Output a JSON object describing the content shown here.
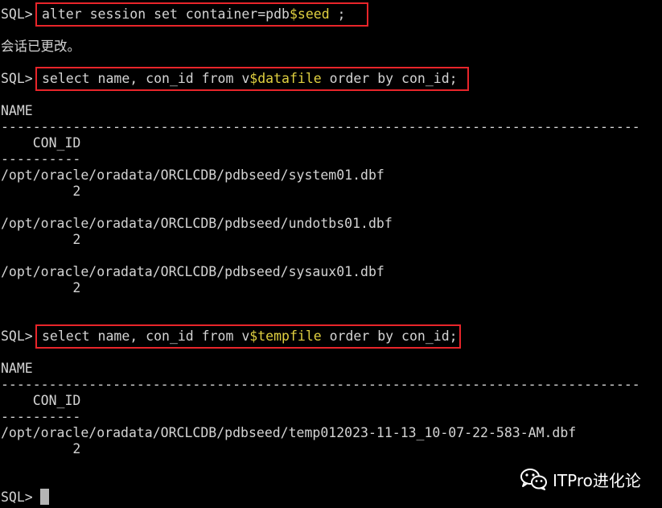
{
  "terminal": {
    "prompt": "SQL>",
    "blocks": [
      {
        "command": {
          "pre": "alter session set container=pdb",
          "var": "$seed",
          "post": " ;"
        },
        "message": "会话已更改。"
      },
      {
        "command": {
          "pre": "select name, con_id from v",
          "var": "$datafile",
          "post": " order by con_id;"
        },
        "col_name": "NAME",
        "name_rule": "--------------------------------------------------------------------------------",
        "col_conid": "    CON_ID",
        "conid_rule": "----------",
        "rows": [
          {
            "name": "/opt/oracle/oradata/ORCLCDB/pdbseed/system01.dbf",
            "con_id": "         2"
          },
          {
            "name": "/opt/oracle/oradata/ORCLCDB/pdbseed/undotbs01.dbf",
            "con_id": "         2"
          },
          {
            "name": "/opt/oracle/oradata/ORCLCDB/pdbseed/sysaux01.dbf",
            "con_id": "         2"
          }
        ]
      },
      {
        "command": {
          "pre": "select name, con_id from v",
          "var": "$tempfile",
          "post": " order by con_id;"
        },
        "col_name": "NAME",
        "name_rule": "--------------------------------------------------------------------------------",
        "col_conid": "    CON_ID",
        "conid_rule": "----------",
        "rows": [
          {
            "name": "/opt/oracle/oradata/ORCLCDB/pdbseed/temp012023-11-13_10-07-22-583-AM.dbf",
            "con_id": "         2"
          }
        ]
      }
    ]
  },
  "watermark": {
    "icon": "wechat-icon",
    "text": "ITPro进化论"
  },
  "colors": {
    "background": "#000000",
    "text": "#d4d4d4",
    "variable": "#e0d040",
    "highlight_box": "#e8252a",
    "cursor": "#b4b4b4"
  }
}
